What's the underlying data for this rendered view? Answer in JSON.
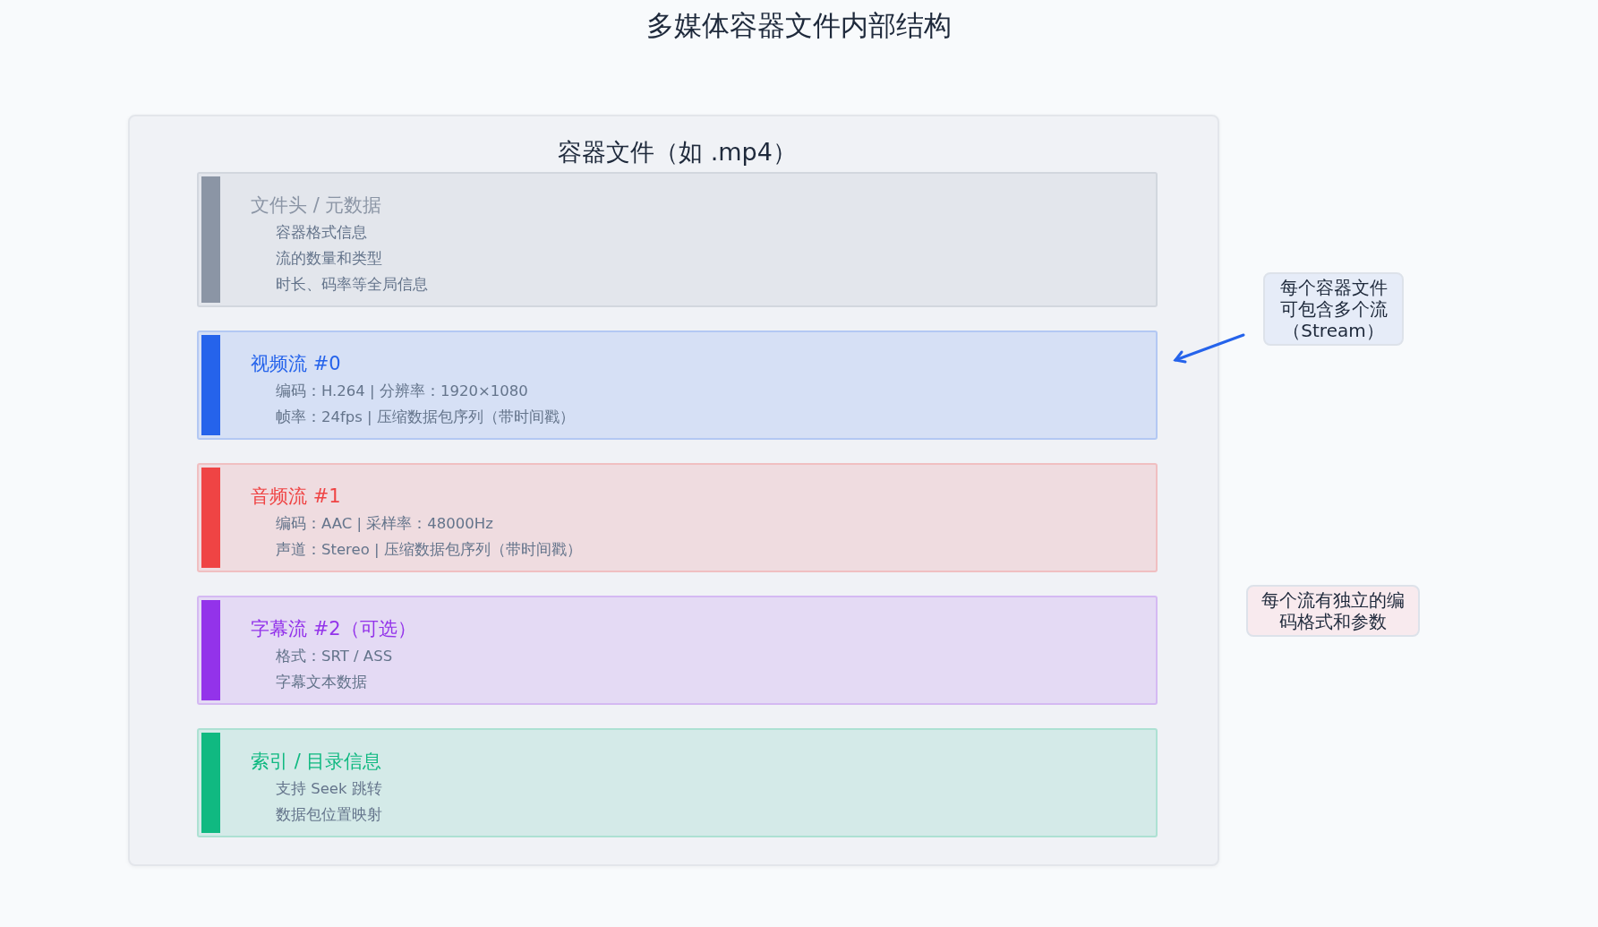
{
  "title": "多媒体容器文件内部结构",
  "container": {
    "title": "容器文件（如 .mp4）",
    "sections": [
      {
        "title": "文件头 / 元数据",
        "color": "#8b95a5",
        "details": [
          "容器格式信息",
          "流的数量和类型",
          "时长、码率等全局信息"
        ]
      },
      {
        "title": "视频流 #0",
        "color": "#2563eb",
        "details": [
          "编码：H.264 | 分辨率：1920×1080",
          "帧率：24fps | 压缩数据包序列（带时间戳）"
        ]
      },
      {
        "title": "音频流 #1",
        "color": "#ef4444",
        "details": [
          "编码：AAC | 采样率：48000Hz",
          "声道：Stereo | 压缩数据包序列（带时间戳）"
        ]
      },
      {
        "title": "字幕流 #2（可选）",
        "color": "#9333ea",
        "details": [
          "格式：SRT / ASS",
          "字幕文本数据"
        ]
      },
      {
        "title": "索引 / 目录信息",
        "color": "#10b981",
        "details": [
          "支持 Seek 跳转",
          "数据包位置映射"
        ]
      }
    ]
  },
  "notes": [
    {
      "text": "每个容器文件可包含多个流（Stream）",
      "color": "#e6ecf8",
      "arrow": true
    },
    {
      "text": "每个流有独立的编码格式和参数",
      "color": "#f8eaee",
      "arrow": false
    }
  ]
}
